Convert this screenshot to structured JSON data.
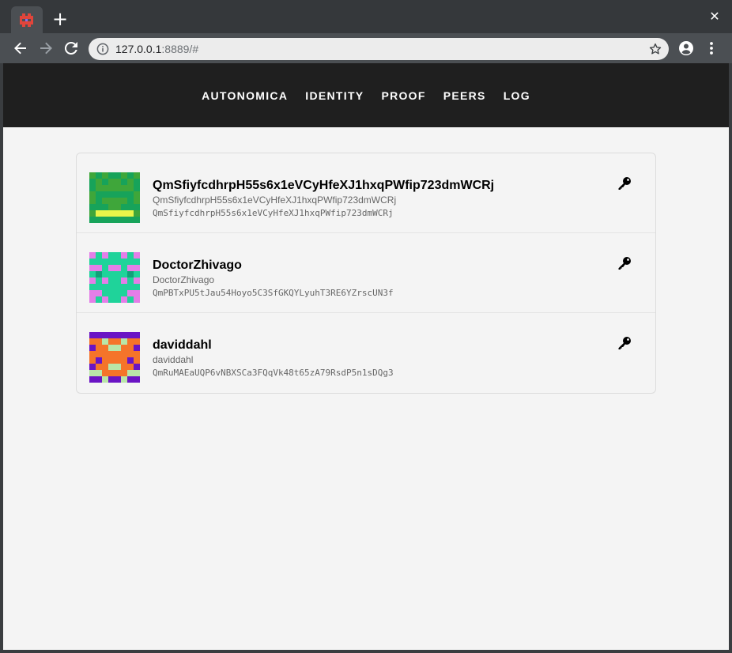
{
  "browser": {
    "new_tab_symbol": "+",
    "close_symbol": "✕",
    "url_host": "127.0.0.1",
    "url_rest": ":8889/#",
    "icons": [
      "back-arrow-icon",
      "forward-arrow-icon",
      "reload-icon",
      "info-icon",
      "star-icon",
      "account-icon",
      "kebab-menu-icon",
      "close-icon"
    ]
  },
  "nav": {
    "items": [
      {
        "label": "AUTONOMICA"
      },
      {
        "label": "IDENTITY"
      },
      {
        "label": "PROOF"
      },
      {
        "label": "PEERS"
      },
      {
        "label": "LOG"
      }
    ]
  },
  "peers": [
    {
      "name": "QmSfiyfcdhrpH55s6x1eVCyHfeXJ1hxqPWfip723dmWCRj",
      "handle": "QmSfiyfcdhrpH55s6x1eVCyHfeXJ1hxqPWfip723dmWCRj",
      "peer_id": "QmSfiyfcdhrpH55s6x1eVCyHfeXJ1hxqPWfip723dmWCRj",
      "avatar_colors": [
        "#3fa63a",
        "#17a35a",
        "#e8f54a"
      ]
    },
    {
      "name": "DoctorZhivago",
      "handle": "DoctorZhivago",
      "peer_id": "QmPBTxPU5tJau54Hoyo5C3SfGKQYLyuhT3RE6YZrscUN3f",
      "avatar_colors": [
        "#e47ee8",
        "#1fd39a",
        "#10a07a"
      ]
    },
    {
      "name": "daviddahl",
      "handle": "daviddahl",
      "peer_id": "QmRuMAEaUQP6vNBXSCa3FQqVk48t65zA79RsdP5n1sDQg3",
      "avatar_colors": [
        "#6a14c4",
        "#f5742a",
        "#b9e6a8"
      ]
    }
  ]
}
